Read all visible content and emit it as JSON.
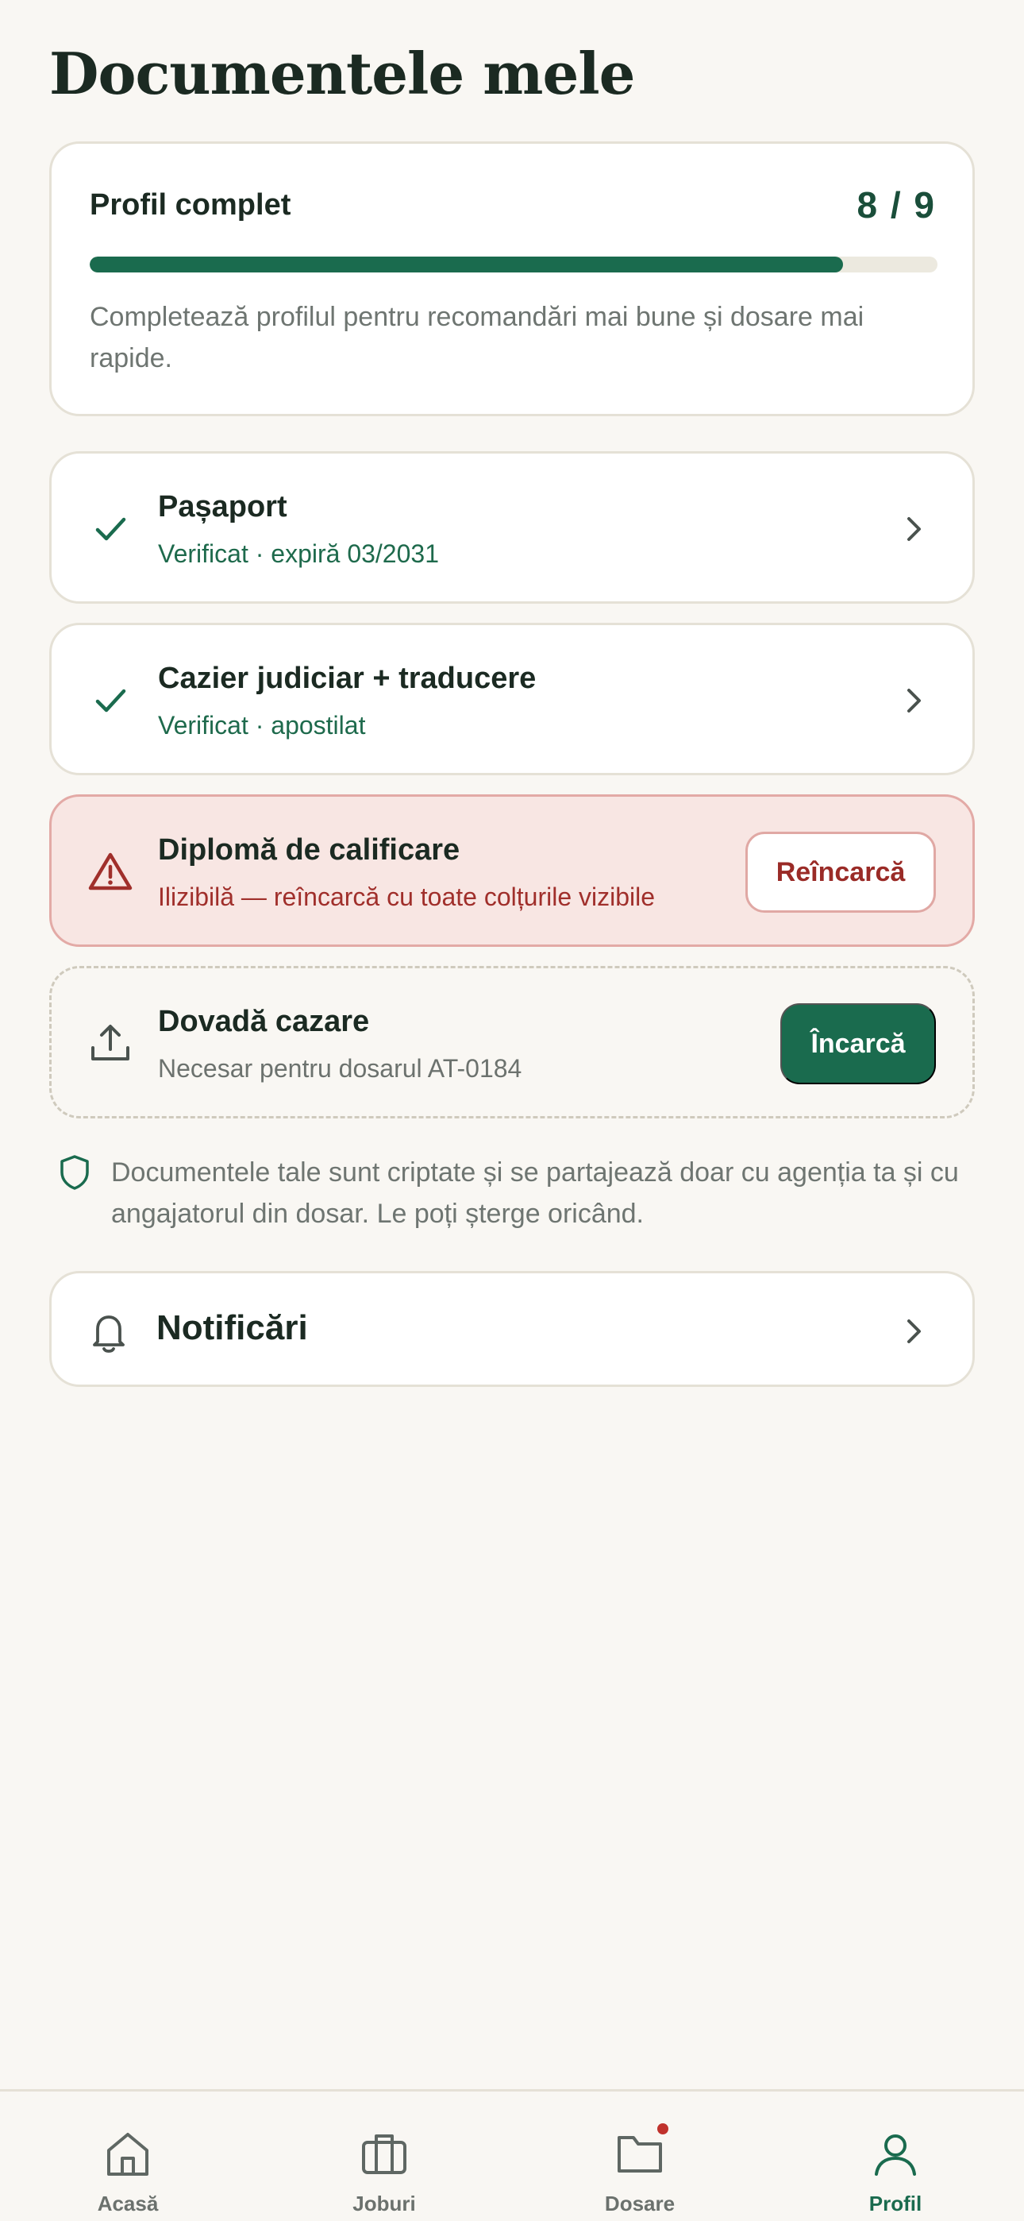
{
  "page": {
    "title": "Documentele mele"
  },
  "profile": {
    "title": "Profil complet",
    "count_text": "8 / 9",
    "completed": 8,
    "total": 9,
    "hint": "Completează profilul pentru recomandări mai bune și dosare mai rapide."
  },
  "documents": [
    {
      "title": "Pașaport",
      "subtitle": "Verificat · expiră 03/2031",
      "status": "verified",
      "icon": "check-icon"
    },
    {
      "title": "Cazier judiciar + traducere",
      "subtitle": "Verificat · apostilat",
      "status": "verified",
      "icon": "check-icon"
    },
    {
      "title": "Diplomă de calificare",
      "subtitle": "Ilizibilă — reîncarcă cu toate colțurile vizibile",
      "status": "error",
      "icon": "warning-icon",
      "action_label": "Reîncarcă"
    },
    {
      "title": "Dovadă cazare",
      "subtitle": "Necesar pentru dosarul AT-0184",
      "status": "missing",
      "icon": "upload-icon",
      "action_label": "Încarcă"
    }
  ],
  "privacy": {
    "text": "Documentele tale sunt criptate și se partajează doar cu agenția ta și cu angajatorul din dosar. Le poți șterge oricând.",
    "icon": "shield-icon"
  },
  "notifications": {
    "label": "Notificări",
    "icon": "bell-icon"
  },
  "tabbar": {
    "items": [
      {
        "label": "Acasă",
        "icon": "home-icon",
        "active": false
      },
      {
        "label": "Joburi",
        "icon": "briefcase-icon",
        "active": false
      },
      {
        "label": "Dosare",
        "icon": "folder-icon",
        "active": false,
        "badge": true
      },
      {
        "label": "Profil",
        "icon": "user-icon",
        "active": true
      }
    ]
  },
  "colors": {
    "accent": "#1a6b4e",
    "error": "#a02f2b",
    "background": "#f9f7f3"
  }
}
